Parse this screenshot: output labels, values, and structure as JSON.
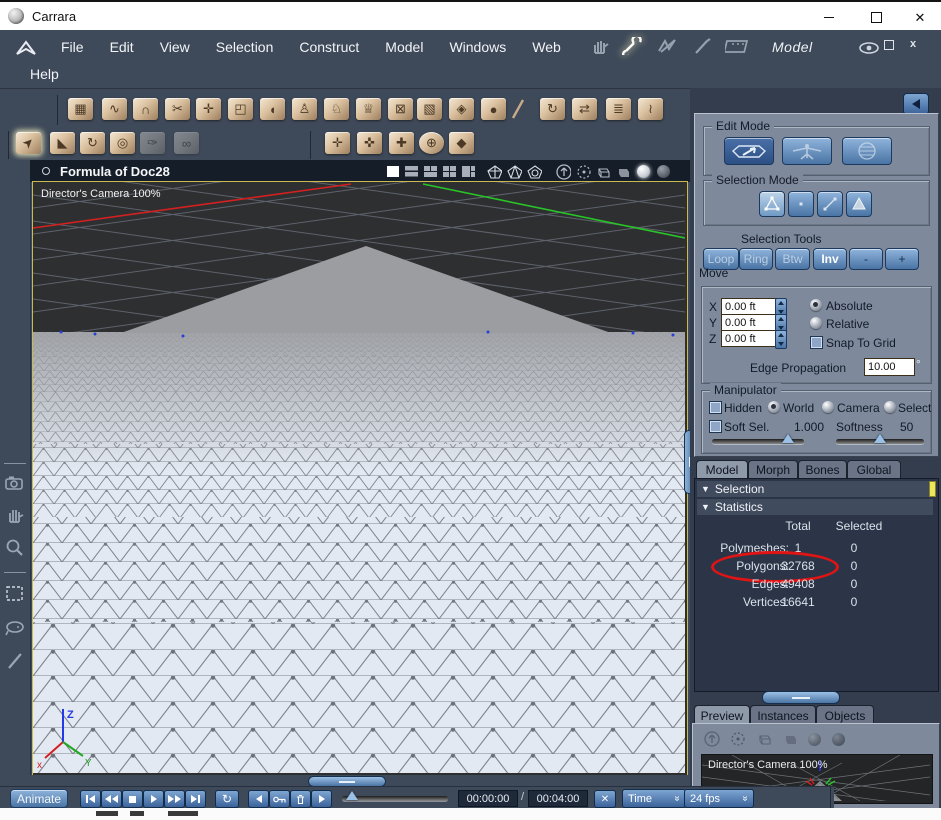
{
  "window": {
    "title": "Carrara"
  },
  "menubar": {
    "items": [
      "File",
      "Edit",
      "View",
      "Selection",
      "Construct",
      "Model",
      "Windows",
      "Web",
      "Help"
    ],
    "mode_label": "Model",
    "icons": [
      "hand-icon",
      "wrench-icon",
      "wireframe-pen-icon",
      "brush-icon",
      "film-icon",
      "eye-icon",
      "restore-icon",
      "close-icon"
    ]
  },
  "toolbar": {
    "row1_icons": [
      "grid-tool-icon",
      "spline-tool-icon",
      "magnet-tool-icon",
      "scissors-tool-icon",
      "add-point-tool-icon",
      "scale-marquee-tool-icon",
      "half-sphere-tool-icon",
      "lathe-tool-icon",
      "sweep-tool-icon",
      "goblet-tool-icon",
      "delete-poly-tool-icon",
      "cube-tool-icon",
      "wrap-tool-icon",
      "sphere-tool-icon",
      "brush-tool-icon",
      "rotate-page-tool-icon",
      "swap-tool-icon",
      "stack-tool-icon",
      "bend-tool-icon"
    ],
    "row2_icons": [
      "select-arrow-tool-icon",
      "prism-select-tool-icon",
      "rotate-tool-icon",
      "ring-tool-icon",
      "eyedropper-tool-icon",
      "link-tool-icon",
      "translate-tool-icon",
      "translate-y-tool-icon",
      "translate-z-tool-icon",
      "universal-manipulator-icon",
      "shield-cube-tool-icon"
    ]
  },
  "left_toolbar": {
    "icons": [
      "camera-icon",
      "pan-hand-icon",
      "zoom-icon",
      "marquee-select-icon",
      "lasso-select-icon",
      "paint-select-icon"
    ]
  },
  "viewport": {
    "title": "Formula of Doc28",
    "camera_label": "Director's Camera 100%",
    "header_icons": [
      "layout-single-icon",
      "layout-rows-icon",
      "layout-three-icon",
      "layout-quad-icon",
      "layout-big-left-icon",
      "wire-sphere-1-icon",
      "wire-sphere-2-icon",
      "wire-sphere-3-icon",
      "camera-up-icon",
      "orbit-icon",
      "wire-cube-icon",
      "solid-cube-icon",
      "shaded-sphere-icon",
      "textured-sphere-icon"
    ]
  },
  "right_panel": {
    "edit_mode": {
      "title": "Edit Mode"
    },
    "selection_mode": {
      "title": "Selection Mode"
    },
    "selection_tools": {
      "title": "Selection Tools",
      "buttons": [
        "Loop",
        "Ring",
        "Btw",
        "Inv",
        "-",
        "+"
      ]
    },
    "move": {
      "label": "Move",
      "axes": [
        {
          "label": "X",
          "value": "0.00 ft"
        },
        {
          "label": "Y",
          "value": "0.00 ft"
        },
        {
          "label": "Z",
          "value": "0.00 ft"
        }
      ],
      "absolute": "Absolute",
      "relative": "Relative",
      "snap_to_grid": "Snap To Grid",
      "edge_propagation_label": "Edge Propagation",
      "edge_propagation_value": "10.00",
      "degree_symbol": "°"
    },
    "manipulator": {
      "title": "Manipulator",
      "hidden": "Hidden",
      "world": "World",
      "camera": "Camera",
      "selection": "Selection",
      "soft_sel": "Soft Sel.",
      "soft_sel_value": "1.000",
      "softness": "Softness",
      "softness_value": "50"
    },
    "tabs": [
      {
        "label": "Model"
      },
      {
        "label": "Morph"
      },
      {
        "label": "Bones"
      },
      {
        "label": "Global"
      }
    ],
    "sections": {
      "selection": "Selection",
      "statistics": "Statistics"
    },
    "statistics": {
      "columns": [
        "Total",
        "Selected"
      ],
      "rows": [
        {
          "label": "Polymeshes:",
          "total": "1",
          "selected": "0"
        },
        {
          "label": "Polygons:",
          "total": "32768",
          "selected": "0"
        },
        {
          "label": "Edges:",
          "total": "49408",
          "selected": "0"
        },
        {
          "label": "Vertices:",
          "total": "16641",
          "selected": "0"
        }
      ],
      "annotation": "red-ellipse-around-polygons"
    },
    "bottom_tabs": [
      {
        "label": "Preview"
      },
      {
        "label": "Instances"
      },
      {
        "label": "Objects"
      }
    ],
    "preview_camera_label": "Director's Camera 100%"
  },
  "timeline": {
    "animate_label": "Animate",
    "transport_icons": [
      "first-frame-icon",
      "rewind-icon",
      "stop-icon",
      "play-icon",
      "fast-forward-icon",
      "last-frame-icon",
      "loop-icon",
      "prev-key-icon",
      "add-key-icon",
      "delete-key-icon",
      "next-key-icon",
      "clear-icon"
    ],
    "current_time": "00:00:00",
    "separator": "/",
    "end_time": "00:04:00",
    "time_mode": "Time",
    "frame_rate": "24 fps"
  },
  "colors": {
    "slate": "#3e4959",
    "panel_gray": "#7e8a9c",
    "accent_blue": "#4a74a4",
    "annotation_red": "#e01414",
    "viewport_border_yellow": "#c9bb52",
    "axis_x_red": "#d42020",
    "axis_y_green": "#22aa22",
    "axis_z_blue": "#2438e8"
  }
}
